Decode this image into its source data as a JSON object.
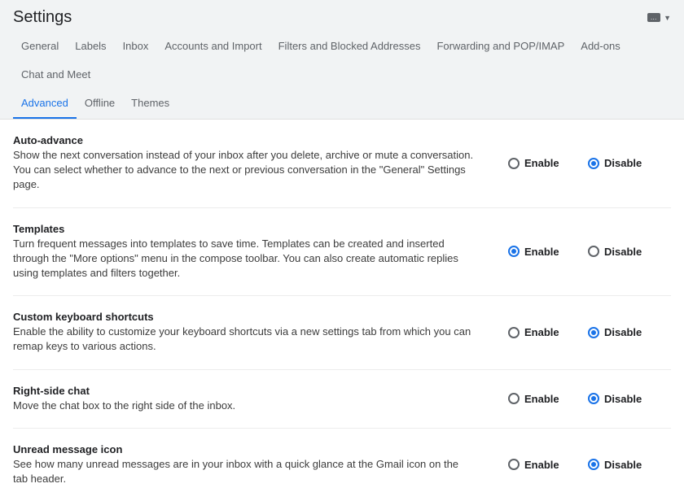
{
  "header": {
    "title": "Settings",
    "lang_chip": "…"
  },
  "tabs_row1": [
    {
      "label": "General",
      "active": false
    },
    {
      "label": "Labels",
      "active": false
    },
    {
      "label": "Inbox",
      "active": false
    },
    {
      "label": "Accounts and Import",
      "active": false
    },
    {
      "label": "Filters and Blocked Addresses",
      "active": false
    },
    {
      "label": "Forwarding and POP/IMAP",
      "active": false
    },
    {
      "label": "Add-ons",
      "active": false
    },
    {
      "label": "Chat and Meet",
      "active": false
    }
  ],
  "tabs_row2": [
    {
      "label": "Advanced",
      "active": true
    },
    {
      "label": "Offline",
      "active": false
    },
    {
      "label": "Themes",
      "active": false
    }
  ],
  "option_labels": {
    "enable": "Enable",
    "disable": "Disable"
  },
  "settings": [
    {
      "title": "Auto-advance",
      "desc": "Show the next conversation instead of your inbox after you delete, archive or mute a conversation. You can select whether to advance to the next or previous conversation in the \"General\" Settings page.",
      "selected": "disable"
    },
    {
      "title": "Templates",
      "desc": "Turn frequent messages into templates to save time. Templates can be created and inserted through the \"More options\" menu in the compose toolbar. You can also create automatic replies using templates and filters together.",
      "selected": "enable"
    },
    {
      "title": "Custom keyboard shortcuts",
      "desc": "Enable the ability to customize your keyboard shortcuts via a new settings tab from which you can remap keys to various actions.",
      "selected": "disable"
    },
    {
      "title": "Right-side chat",
      "desc": "Move the chat box to the right side of the inbox.",
      "selected": "disable"
    },
    {
      "title": "Unread message icon",
      "desc": "See how many unread messages are in your inbox with a quick glance at the Gmail icon on the tab header.",
      "selected": "disable"
    }
  ]
}
